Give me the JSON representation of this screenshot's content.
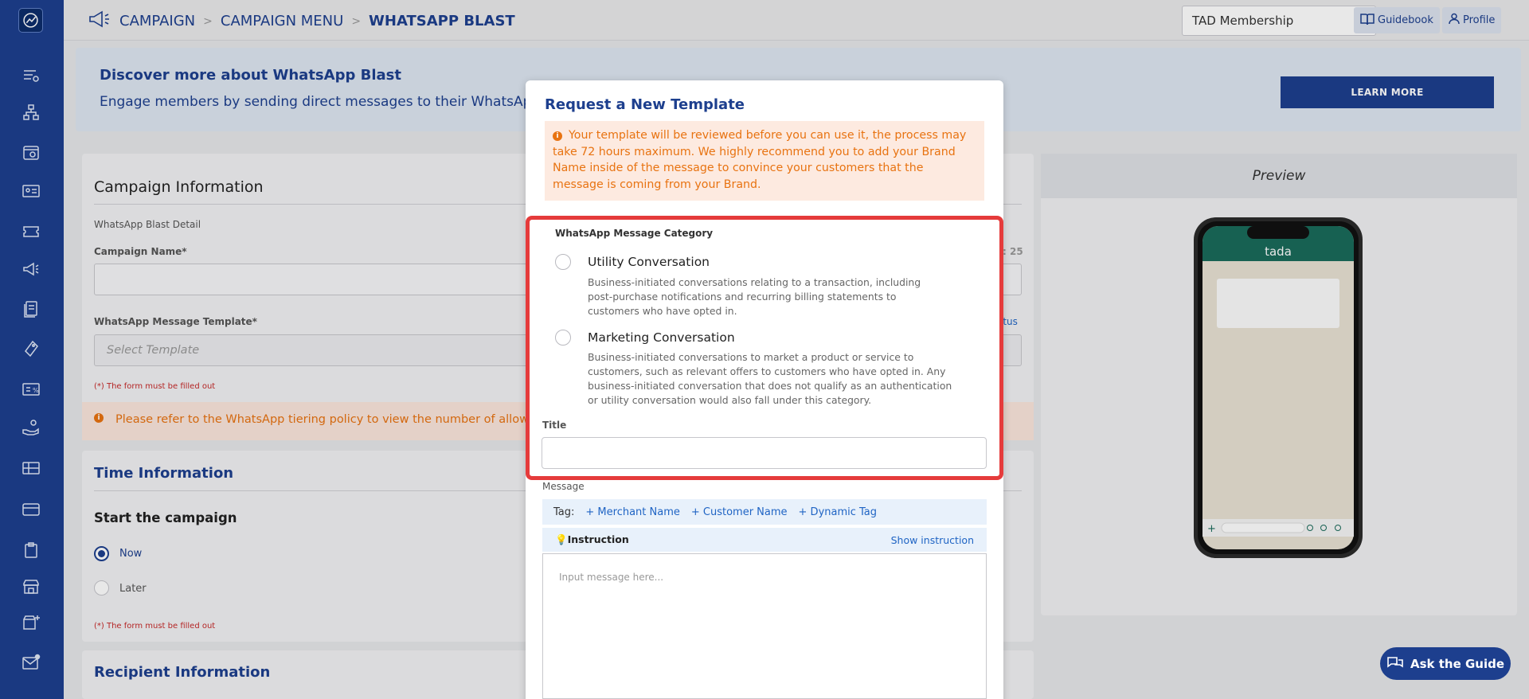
{
  "breadcrumb": {
    "items": [
      "CAMPAIGN",
      "CAMPAIGN MENU",
      "WHATSAPP BLAST"
    ]
  },
  "membership_select": {
    "value": "TAD Membership"
  },
  "top_buttons": {
    "guidebook": "Guidebook",
    "profile": "Profile"
  },
  "banner": {
    "title": "Discover more about WhatsApp Blast",
    "text": "Engage members by sending direct messages to their WhatsApp to",
    "learn_more": "LEARN MORE"
  },
  "campaign": {
    "title": "Campaign Information",
    "section": "WhatsApp Blast Detail",
    "name_label": "Campaign Name*",
    "template_label": "WhatsApp Message Template*",
    "template_placeholder": "Select Template",
    "error": "(*) The form must be filled out",
    "char_count_fragment": ": 25",
    "status_link_fragment": "atus",
    "tier_notice": "Please refer to the WhatsApp tiering policy to view the number of allowed recip"
  },
  "time": {
    "title": "Time Information",
    "subtitle": "Start the campaign",
    "options": [
      "Now",
      "Later"
    ],
    "error": "(*) The form must be filled out"
  },
  "recipient": {
    "title": "Recipient Information"
  },
  "preview": {
    "title": "Preview",
    "app_name": "tada"
  },
  "modal": {
    "title": "Request a New Template",
    "warning": "Your template will be reviewed before you can use it, the process may take 72 hours maximum. We highly recommend you to add your Brand Name inside of the message to convince your customers that the message is coming from your Brand.",
    "category_label": "WhatsApp Message Category",
    "options": [
      {
        "title": "Utility Conversation",
        "desc": "Business-initiated conversations relating to a transaction, including post-purchase notifications and recurring billing statements to customers who have opted in."
      },
      {
        "title": "Marketing Conversation",
        "desc": "Business-initiated conversations to market a product or service to customers, such as relevant offers to customers who have opted in. Any business-initiated conversation that does not qualify as an authentication or utility conversation would also fall under this category."
      }
    ],
    "title_label": "Title",
    "message_label": "Message",
    "tag_label": "Tag:",
    "tags": [
      "+ Merchant Name",
      "+ Customer Name",
      "+ Dynamic Tag"
    ],
    "instruction": "Instruction",
    "show_instruction": "Show instruction",
    "message_placeholder": "Input message here..."
  },
  "ask_guide": "Ask the Guide",
  "colors": {
    "brand": "#1d3f8e",
    "warning": "#e87311",
    "error": "#c62828",
    "highlight": "#e53b3b",
    "whatsapp": "#1a6b5b"
  }
}
